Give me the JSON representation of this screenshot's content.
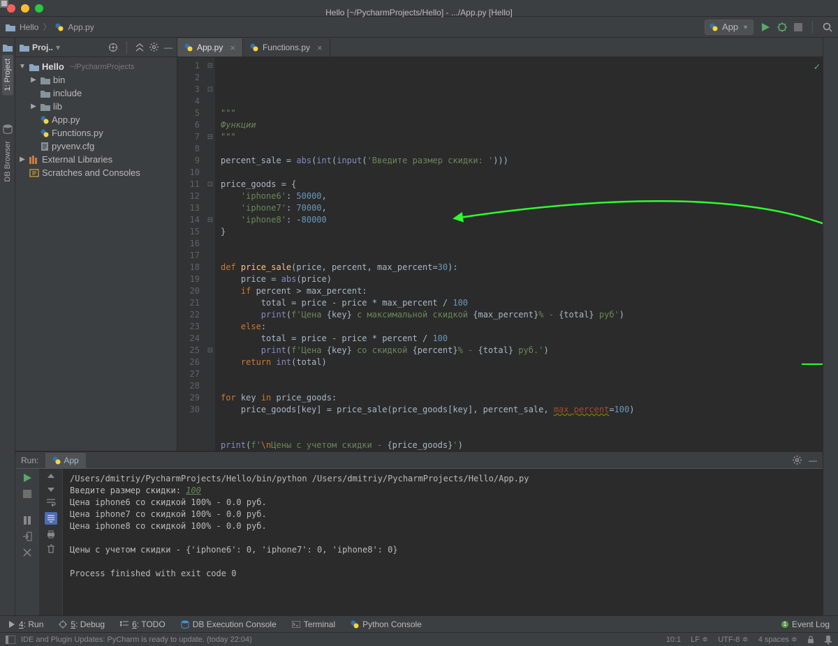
{
  "window_title": "Hello [~/PycharmProjects/Hello] - .../App.py [Hello]",
  "breadcrumbs": {
    "project": "Hello",
    "file": "App.py"
  },
  "run_config": {
    "label": "App"
  },
  "left_gutter": {
    "project": "1: Project",
    "db": "DB Browser"
  },
  "project_pane": {
    "title": "Proj..",
    "root": "Hello",
    "root_path": "~/PycharmProjects",
    "items": [
      "bin",
      "include",
      "lib",
      "App.py",
      "Functions.py",
      "pyvenv.cfg"
    ],
    "external": "External Libraries",
    "scratches": "Scratches and Consoles"
  },
  "editor": {
    "tabs": [
      {
        "label": "App.py",
        "active": true
      },
      {
        "label": "Functions.py",
        "active": false
      }
    ],
    "line_start": 1,
    "line_end": 30
  },
  "code_lines": [
    {
      "frag": [
        {
          "c": "str",
          "t": "\"\"\""
        }
      ]
    },
    {
      "frag": [
        {
          "c": "str",
          "t": "Функции"
        }
      ]
    },
    {
      "frag": [
        {
          "c": "str",
          "t": "\"\"\""
        }
      ]
    },
    {
      "frag": []
    },
    {
      "frag": [
        {
          "c": "op",
          "t": "percent_sale = "
        },
        {
          "c": "bi",
          "t": "abs"
        },
        {
          "c": "op",
          "t": "("
        },
        {
          "c": "bi",
          "t": "int"
        },
        {
          "c": "op",
          "t": "("
        },
        {
          "c": "bi",
          "t": "input"
        },
        {
          "c": "op",
          "t": "("
        },
        {
          "c": "fstr",
          "t": "'Введите размер скидки: '"
        },
        {
          "c": "op",
          "t": ")))"
        }
      ]
    },
    {
      "frag": []
    },
    {
      "frag": [
        {
          "c": "op",
          "t": "price_goods = {"
        }
      ]
    },
    {
      "frag": [
        {
          "c": "op",
          "t": "    "
        },
        {
          "c": "fstr",
          "t": "'iphone6'"
        },
        {
          "c": "op",
          "t": ": "
        },
        {
          "c": "num",
          "t": "50000"
        },
        {
          "c": "op",
          "t": ","
        }
      ]
    },
    {
      "frag": [
        {
          "c": "op",
          "t": "    "
        },
        {
          "c": "fstr",
          "t": "'iphone7'"
        },
        {
          "c": "op",
          "t": ": "
        },
        {
          "c": "num",
          "t": "70000"
        },
        {
          "c": "op",
          "t": ","
        }
      ]
    },
    {
      "frag": [
        {
          "c": "op",
          "t": "    "
        },
        {
          "c": "fstr",
          "t": "'iphone8'"
        },
        {
          "c": "op",
          "t": ": -"
        },
        {
          "c": "num",
          "t": "80000"
        }
      ]
    },
    {
      "frag": [
        {
          "c": "op",
          "t": "}"
        }
      ]
    },
    {
      "frag": []
    },
    {
      "frag": []
    },
    {
      "frag": [
        {
          "c": "kw",
          "t": "def "
        },
        {
          "c": "fn",
          "t": "price_sale"
        },
        {
          "c": "op",
          "t": "(price, percent, max_percent="
        },
        {
          "c": "num",
          "t": "30"
        },
        {
          "c": "op",
          "t": "):"
        }
      ]
    },
    {
      "frag": [
        {
          "c": "op",
          "t": "    price = "
        },
        {
          "c": "bi",
          "t": "abs"
        },
        {
          "c": "op",
          "t": "(price)"
        }
      ]
    },
    {
      "frag": [
        {
          "c": "op",
          "t": "    "
        },
        {
          "c": "kw",
          "t": "if"
        },
        {
          "c": "op",
          "t": " percent > max_percent:"
        }
      ]
    },
    {
      "frag": [
        {
          "c": "op",
          "t": "        total = price - price * max_percent / "
        },
        {
          "c": "num",
          "t": "100"
        }
      ]
    },
    {
      "frag": [
        {
          "c": "op",
          "t": "        "
        },
        {
          "c": "bi",
          "t": "print"
        },
        {
          "c": "op",
          "t": "("
        },
        {
          "c": "fstr",
          "t": "f'Цена "
        },
        {
          "c": "op",
          "t": "{key}"
        },
        {
          "c": "fstr",
          "t": " с максимальной скидкой "
        },
        {
          "c": "op",
          "t": "{max_percent}"
        },
        {
          "c": "fstr",
          "t": "% - "
        },
        {
          "c": "op",
          "t": "{total}"
        },
        {
          "c": "fstr",
          "t": " руб'"
        },
        {
          "c": "op",
          "t": ")"
        }
      ]
    },
    {
      "frag": [
        {
          "c": "op",
          "t": "    "
        },
        {
          "c": "kw",
          "t": "else"
        },
        {
          "c": "op",
          "t": ":"
        }
      ]
    },
    {
      "frag": [
        {
          "c": "op",
          "t": "        total = price - price * percent / "
        },
        {
          "c": "num",
          "t": "100"
        }
      ]
    },
    {
      "frag": [
        {
          "c": "op",
          "t": "        "
        },
        {
          "c": "bi",
          "t": "print"
        },
        {
          "c": "op",
          "t": "("
        },
        {
          "c": "fstr",
          "t": "f'Цена "
        },
        {
          "c": "op",
          "t": "{key}"
        },
        {
          "c": "fstr",
          "t": " со скидкой "
        },
        {
          "c": "op",
          "t": "{percent}"
        },
        {
          "c": "fstr",
          "t": "% - "
        },
        {
          "c": "op",
          "t": "{total}"
        },
        {
          "c": "fstr",
          "t": " руб.'"
        },
        {
          "c": "op",
          "t": ")"
        }
      ]
    },
    {
      "frag": [
        {
          "c": "op",
          "t": "    "
        },
        {
          "c": "kw",
          "t": "return "
        },
        {
          "c": "bi",
          "t": "int"
        },
        {
          "c": "op",
          "t": "(total)"
        }
      ]
    },
    {
      "frag": []
    },
    {
      "frag": []
    },
    {
      "frag": [
        {
          "c": "kw",
          "t": "for "
        },
        {
          "c": "op",
          "t": "key "
        },
        {
          "c": "kw",
          "t": "in "
        },
        {
          "c": "op",
          "t": "price_goods:"
        }
      ]
    },
    {
      "frag": [
        {
          "c": "op",
          "t": "    price_goods[key] = price_sale(price_goods[key], percent_sale, "
        },
        {
          "c": "kwarg",
          "t": "max_percent"
        },
        {
          "c": "op",
          "t": "="
        },
        {
          "c": "num",
          "t": "100"
        },
        {
          "c": "op",
          "t": ")"
        }
      ]
    },
    {
      "frag": []
    },
    {
      "frag": []
    },
    {
      "frag": [
        {
          "c": "bi",
          "t": "print"
        },
        {
          "c": "op",
          "t": "("
        },
        {
          "c": "fstr",
          "t": "f'"
        },
        {
          "c": "kw",
          "t": "\\n"
        },
        {
          "c": "fstr",
          "t": "Цены с учетом скидки - "
        },
        {
          "c": "op",
          "t": "{price_goods}"
        },
        {
          "c": "fstr",
          "t": "'"
        },
        {
          "c": "op",
          "t": ")"
        }
      ]
    },
    {
      "frag": []
    }
  ],
  "run": {
    "label": "Run:",
    "tab": "App",
    "lines": [
      "/Users/dmitriy/PycharmProjects/Hello/bin/python /Users/dmitriy/PycharmProjects/Hello/App.py",
      [
        "Введите размер скидки: ",
        "100"
      ],
      "Цена iphone6 со скидкой 100% - 0.0 руб.",
      "Цена iphone7 со скидкой 100% - 0.0 руб.",
      "Цена iphone8 со скидкой 100% - 0.0 руб.",
      "",
      "Цены с учетом скидки - {'iphone6': 0, 'iphone7': 0, 'iphone8': 0}",
      "",
      "Process finished with exit code 0"
    ]
  },
  "bottom_tools": {
    "run": "4: Run",
    "debug": "5: Debug",
    "todo": "6: TODO",
    "db": "DB Execution Console",
    "terminal": "Terminal",
    "pyconsole": "Python Console",
    "eventlog": "Event Log"
  },
  "status": {
    "msg": "IDE and Plugin Updates: PyCharm is ready to update. (today 22:04)",
    "pos": "10:1",
    "lf": "LF",
    "enc": "UTF-8",
    "indent": "4 spaces"
  }
}
